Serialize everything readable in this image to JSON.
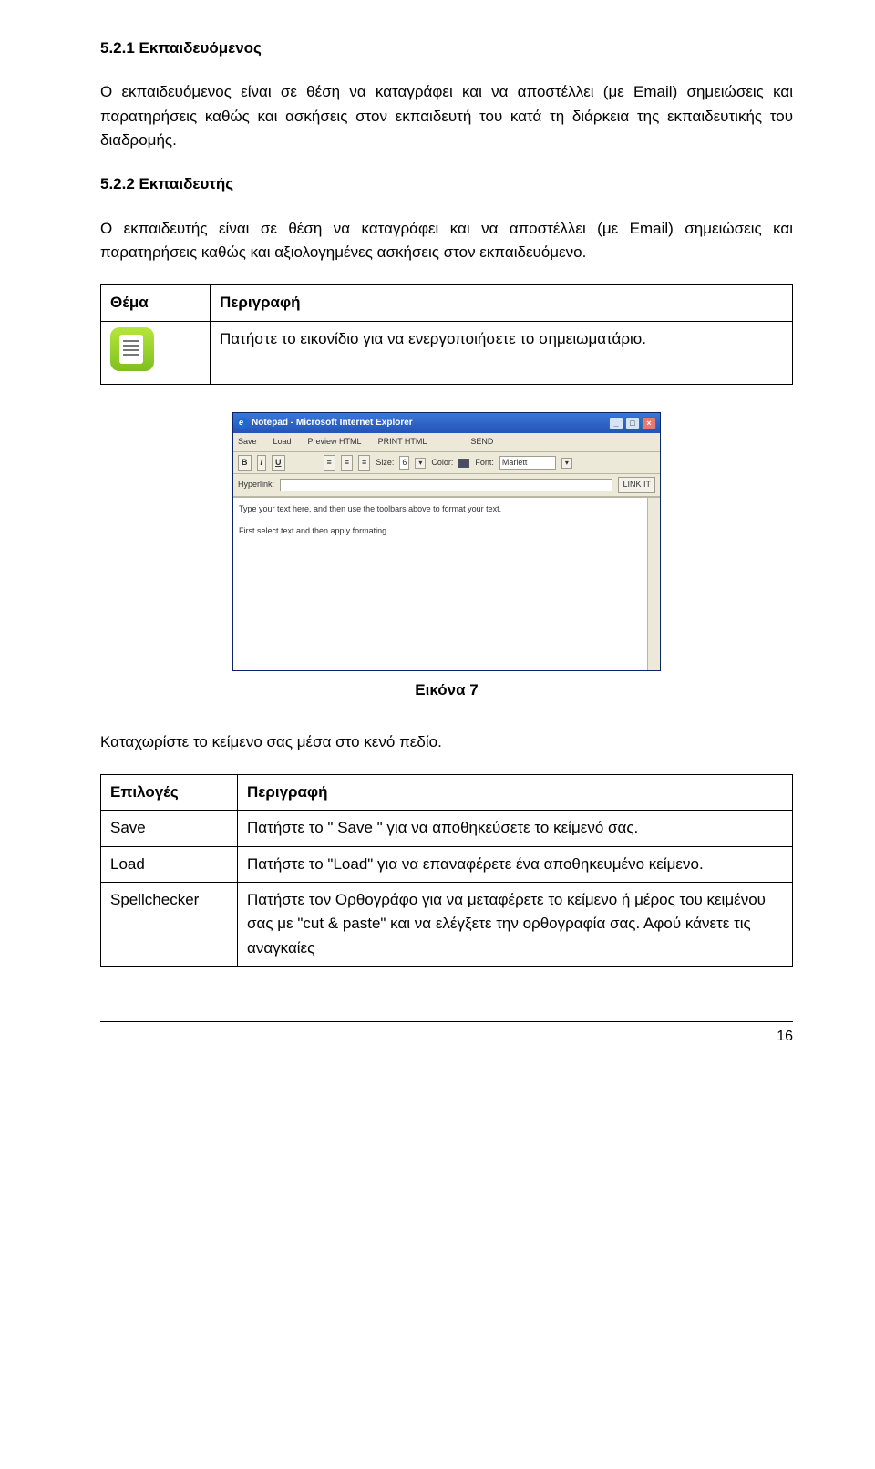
{
  "section521": {
    "heading": "5.2.1  Εκπαιδευόμενος",
    "para": "Ο εκπαιδευόμενος είναι σε θέση να καταγράφει και να αποστέλλει (με Email) σημειώσεις και παρατηρήσεις καθώς και ασκήσεις στον εκπαιδευτή του κατά τη διάρκεια της εκπαιδευτικής του διαδρομής."
  },
  "section522": {
    "heading": "5.2.2  Εκπαιδευτής",
    "para": "Ο εκπαιδευτής είναι σε θέση να καταγράφει και να αποστέλλει (με Email) σημειώσεις και παρατηρήσεις καθώς και αξιολογημένες ασκήσεις στον εκπαιδευόμενο."
  },
  "table1": {
    "th1": "Θέμα",
    "th2": "Περιγραφή",
    "row1_desc": "Πατήστε το εικονίδιο για να ενεργοποιήσετε το σημειωματάριο."
  },
  "notepad": {
    "title": "Notepad - Microsoft Internet Explorer",
    "menu": {
      "save": "Save",
      "load": "Load",
      "preview": "Preview HTML",
      "print": "PRINT HTML",
      "send": "SEND"
    },
    "toolbar": {
      "b": "B",
      "i": "I",
      "u": "U",
      "size_label": "Size:",
      "size_value": "6",
      "color_label": "Color:",
      "font_label": "Font:",
      "font_value": "Marlett"
    },
    "hyperlink_label": "Hyperlink:",
    "linkit": "LINK IT",
    "editor_line1": "Type your text here, and then use the toolbars above to format your text.",
    "editor_line2": "First select text and then apply formating."
  },
  "caption": "Εικόνα 7",
  "after_image_para": "Καταχωρίστε το κείμενο σας μέσα στο κενό πεδίο.",
  "table2": {
    "th1": "Επιλογές",
    "th2": "Περιγραφή",
    "r1_opt": "Save",
    "r1_desc": "Πατήστε το \" Save \" για να αποθηκεύσετε το κείμενό σας.",
    "r2_opt": "Load",
    "r2_desc": "Πατήστε το \"Load\" για να επαναφέρετε ένα αποθηκευμένο κείμενο.",
    "r3_opt": "Spellchecker",
    "r3_desc": "Πατήστε τον Ορθογράφο για να μεταφέρετε το κείμενο ή μέρος του κειμένου σας με \"cut & paste\" και να ελέγξετε την ορθογραφία σας. Αφού κάνετε τις αναγκαίες"
  },
  "page_number": "16"
}
